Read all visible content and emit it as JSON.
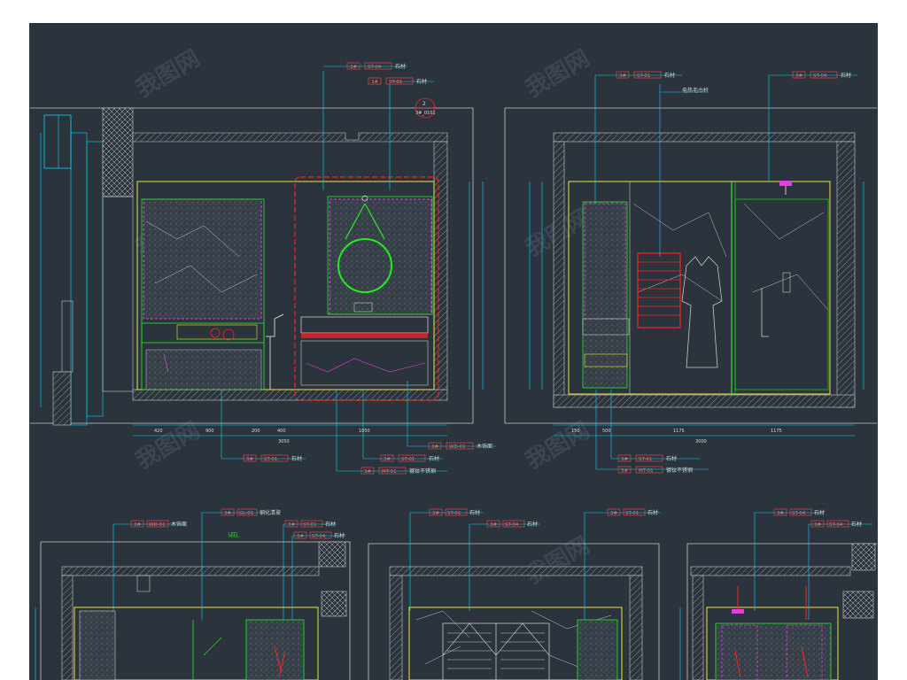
{
  "colors": {
    "background": "#2b333d",
    "frame_white": "#ffffff",
    "cyan": "#00d8ff",
    "yellow": "#e8e83a",
    "green": "#22ee22",
    "magenta": "#e040e0",
    "red": "#ff2222",
    "grey": "#c8c8c8",
    "label_red": "#ff4a4a"
  },
  "watermark": "我图网",
  "callouts_top_left": [
    {
      "num": "3#",
      "code": "ST-04",
      "text": "石材"
    },
    {
      "num": "3#",
      "code": "ST-01",
      "text": "石材"
    }
  ],
  "detail_marker": {
    "num": "2",
    "ref": "3#_0101"
  },
  "callouts_bottom_left": [
    {
      "num": "3#",
      "code": "WD-01",
      "text": "木饰面"
    },
    {
      "num": "3#",
      "code": "ST-01",
      "text": "石材"
    },
    {
      "num": "3#",
      "code": "ST-01",
      "text": "石材"
    },
    {
      "num": "3#",
      "code": "MT-01",
      "text": "镀钛不锈钢"
    }
  ],
  "callouts_top_right": [
    {
      "num": "3#",
      "code": "ST-01",
      "text": "石材"
    },
    {
      "num": "3#",
      "code": "ST-04",
      "text": "石材"
    }
  ],
  "towel_rail_label": "电热毛巾杆",
  "callouts_bottom_right": [
    {
      "num": "3#",
      "code": "ST-01",
      "text": "石材"
    },
    {
      "num": "3#",
      "code": "MT-01",
      "text": "镀钛不锈钢"
    }
  ],
  "dims_left": [
    "420",
    "900",
    "200",
    "400",
    "1050"
  ],
  "dim_left_total": "3050",
  "dims_right": [
    "150",
    "500",
    "1175",
    "1175"
  ],
  "dims_right_total": "3000",
  "callouts_lower_a": [
    {
      "num": "3#",
      "code": "GL-01",
      "text": "钢化清玻"
    },
    {
      "num": "3#",
      "code": "WD-01",
      "text": "木饰面"
    },
    {
      "num": "3#",
      "code": "ST-01",
      "text": "石材"
    },
    {
      "num": "3#",
      "code": "ST-04",
      "text": "石材"
    }
  ],
  "led_label": "LED",
  "callouts_lower_b": [
    {
      "num": "3#",
      "code": "ST-01",
      "text": "石材"
    },
    {
      "num": "3#",
      "code": "ST-04",
      "text": "石材"
    },
    {
      "num": "3#",
      "code": "ST-01",
      "text": "石材"
    }
  ],
  "callouts_lower_c": [
    {
      "num": "3#",
      "code": "ST-04",
      "text": "石材"
    },
    {
      "num": "3#",
      "code": "ST-04",
      "text": "石材"
    }
  ]
}
